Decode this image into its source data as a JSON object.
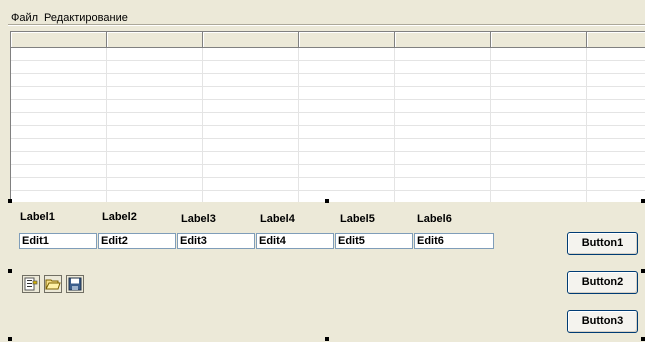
{
  "menu": {
    "items": [
      "Файл",
      "Редактирование"
    ]
  },
  "grid": {
    "columns": 7,
    "rows": 12
  },
  "fields": [
    {
      "label": "Label1",
      "value": "Edit1"
    },
    {
      "label": "Label2",
      "value": "Edit2"
    },
    {
      "label": "Label3",
      "value": "Edit3"
    },
    {
      "label": "Label4",
      "value": "Edit4"
    },
    {
      "label": "Label5",
      "value": "Edit5"
    },
    {
      "label": "Label6",
      "value": "Edit6"
    }
  ],
  "toolbar": {
    "icons": [
      "properties-icon",
      "open-folder-icon",
      "save-disk-icon"
    ]
  },
  "buttons": [
    "Button1",
    "Button2",
    "Button3"
  ],
  "colors": {
    "window_bg": "#ECE9D8",
    "edit_border": "#7F9DB9",
    "button_border": "#003C74"
  }
}
